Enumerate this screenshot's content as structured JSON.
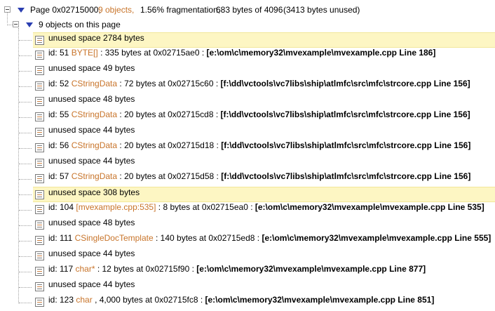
{
  "page": {
    "label": "Page 0x02715000,",
    "objects": "9 objects,",
    "fragmentation": "1.56% fragmentation,",
    "bytes": "683 bytes of 4096",
    "unused": "(3413 bytes unused)"
  },
  "group_label": "9 objects on this page",
  "rows": [
    {
      "id": "unused space 2784 bytes"
    },
    {
      "id": "id: 51",
      "type": "BYTE[]",
      "size": ": 335 bytes at 0x02715ae0 :",
      "file": "[e:\\om\\c\\memory32\\mvexample\\mvexample.cpp Line 186]"
    },
    {
      "id": "unused space 49 bytes"
    },
    {
      "id": "id: 52",
      "type": "CStringData",
      "size": ": 72 bytes at 0x02715c60 :",
      "file": "[f:\\dd\\vctools\\vc7libs\\ship\\atlmfc\\src\\mfc\\strcore.cpp Line 156]"
    },
    {
      "id": "unused space 48 bytes"
    },
    {
      "id": "id: 55",
      "type": "CStringData",
      "size": ": 20 bytes at 0x02715cd8 :",
      "file": "[f:\\dd\\vctools\\vc7libs\\ship\\atlmfc\\src\\mfc\\strcore.cpp Line 156]"
    },
    {
      "id": "unused space 44 bytes"
    },
    {
      "id": "id: 56",
      "type": "CStringData",
      "size": ": 20 bytes at 0x02715d18 :",
      "file": "[f:\\dd\\vctools\\vc7libs\\ship\\atlmfc\\src\\mfc\\strcore.cpp Line 156]"
    },
    {
      "id": "unused space 44 bytes"
    },
    {
      "id": "id: 57",
      "type": "CStringData",
      "size": ": 20 bytes at 0x02715d58 :",
      "file": "[f:\\dd\\vctools\\vc7libs\\ship\\atlmfc\\src\\mfc\\strcore.cpp Line 156]"
    },
    {
      "id": "unused space 308 bytes"
    },
    {
      "id": "id: 104",
      "type": "[mvexample.cpp:535]",
      "size": ": 8 bytes at 0x02715ea0 :",
      "file": "[e:\\om\\c\\memory32\\mvexample\\mvexample.cpp Line 535]"
    },
    {
      "id": "unused space 48 bytes"
    },
    {
      "id": "id: 111",
      "type": "CSingleDocTemplate",
      "size": ": 140 bytes at 0x02715ed8 :",
      "file": "[e:\\om\\c\\memory32\\mvexample\\mvexample.cpp Line 555]"
    },
    {
      "id": "unused space 44 bytes"
    },
    {
      "id": "id: 117",
      "type": "char*",
      "size": ": 12 bytes at 0x02715f90 :",
      "file": "[e:\\om\\c\\memory32\\mvexample\\mvexample.cpp Line 877]"
    },
    {
      "id": "unused space 44 bytes"
    },
    {
      "id": "id: 123",
      "type": "char",
      "size": ", 4,000 bytes at 0x02715fc8 :",
      "file": "[e:\\om\\c\\memory32\\mvexample\\mvexample.cpp Line 851]"
    }
  ],
  "colors": {
    "highlight": "#fdf6c3",
    "type_text": "#c8742a",
    "expand_arrow": "#2a3eb1"
  },
  "icons": {
    "row": "document-list-icon",
    "expand": "triangle-down-icon",
    "collapse": "minus-box-icon"
  }
}
